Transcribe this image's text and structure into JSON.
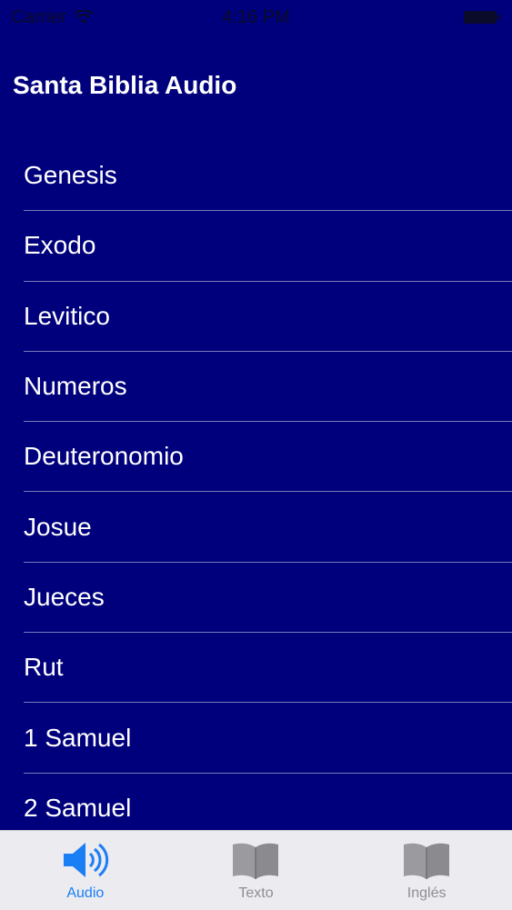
{
  "status_bar": {
    "carrier": "Carrier",
    "time": "4:16 PM"
  },
  "nav": {
    "title": "Santa Biblia Audio"
  },
  "books": [
    {
      "label": "Genesis"
    },
    {
      "label": "Exodo"
    },
    {
      "label": "Levitico"
    },
    {
      "label": "Numeros"
    },
    {
      "label": "Deuteronomio"
    },
    {
      "label": "Josue"
    },
    {
      "label": "Jueces"
    },
    {
      "label": "Rut"
    },
    {
      "label": "1 Samuel"
    },
    {
      "label": "2 Samuel"
    }
  ],
  "tabs": [
    {
      "label": "Audio",
      "icon": "speaker-icon",
      "active": true
    },
    {
      "label": "Texto",
      "icon": "book-icon",
      "active": false
    },
    {
      "label": "Inglés",
      "icon": "book-icon",
      "active": false
    }
  ],
  "colors": {
    "background": "#00007c",
    "tab_active": "#1a7ef5",
    "tab_inactive": "#8e8e93"
  }
}
